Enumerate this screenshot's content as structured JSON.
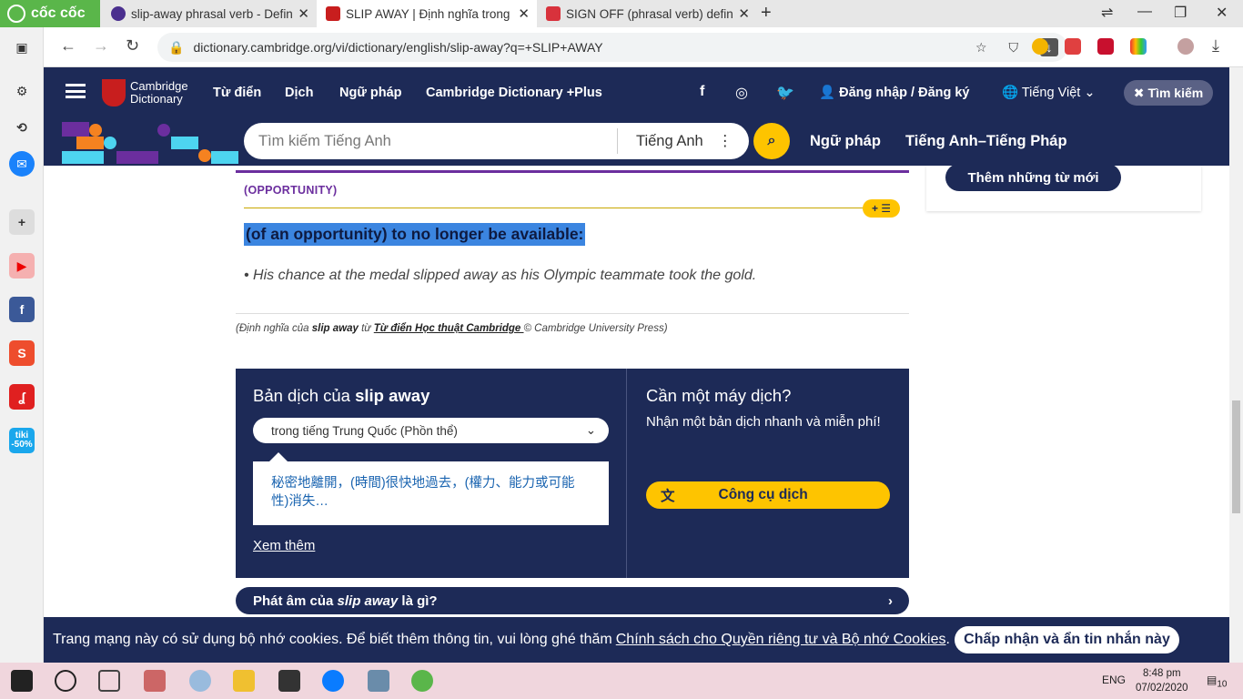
{
  "browser": {
    "brand": "cốc cốc",
    "tabs": [
      {
        "title": "slip-away phrasal verb - Defin",
        "active": false
      },
      {
        "title": "SLIP AWAY | Định nghĩa trong",
        "active": true
      },
      {
        "title": "SIGN OFF (phrasal verb) defin",
        "active": false
      }
    ],
    "url": "dictionary.cambridge.org/vi/dictionary/english/slip-away?q=+SLIP+AWAY"
  },
  "header": {
    "logo_line1": "Cambridge",
    "logo_line2": "Dictionary",
    "nav": [
      "Từ điển",
      "Dịch",
      "Ngữ pháp",
      "Cambridge Dictionary +Plus"
    ],
    "login": "Đăng nhập / Đăng ký",
    "language": "Tiếng Việt",
    "search_toggle": "Tìm kiếm"
  },
  "search": {
    "placeholder": "Tìm kiếm Tiếng Anh",
    "dict_select": "Tiếng Anh",
    "links": [
      "Ngữ pháp",
      "Tiếng Anh–Tiếng Pháp"
    ]
  },
  "entry": {
    "guideword": "(OPPORTUNITY)",
    "definition": "(of an opportunity) to no longer be available:",
    "example": "His chance at the medal slipped away as his Olympic teammate took the gold.",
    "credit_prefix": "(Định nghĩa của ",
    "credit_word": "slip away",
    "credit_mid": " từ ",
    "credit_source": "Từ điển Học thuật Cambridge ",
    "credit_suffix": "© Cambridge University Press)"
  },
  "translation": {
    "heading_prefix": "Bản dịch của ",
    "heading_word": "slip away",
    "dropdown": "trong tiếng Trung Quốc (Phồn thể)",
    "result": "秘密地離開，(時間)很快地過去，(權力、能力或可能性)消失…",
    "more": "Xem thêm",
    "tool_heading": "Cần một máy dịch?",
    "tool_text": "Nhận một bản dịch nhanh và miễn phí!",
    "tool_button": "Công cụ dịch"
  },
  "pronunciation": {
    "prefix": "Phát âm của ",
    "word": "slip away",
    "suffix": " là gì?"
  },
  "sidebar_card": {
    "button": "Thêm những từ mới"
  },
  "cookie": {
    "text": "Trang mạng này có sử dụng bộ nhớ cookies. Để biết thêm thông tin, vui lòng ghé thăm",
    "link": "Chính sách cho Quyền riêng tư và Bộ nhớ Cookies",
    "end": ".",
    "accept": "Chấp nhận và ẩn tin nhắn này"
  },
  "taskbar": {
    "lang": "ENG",
    "time": "8:48 pm",
    "date": "07/02/2020",
    "notif": "10"
  },
  "colors": {
    "navy": "#1d2a57",
    "yellow": "#fec400",
    "purple": "#6b2e9e",
    "highlight": "#3b85e0"
  }
}
